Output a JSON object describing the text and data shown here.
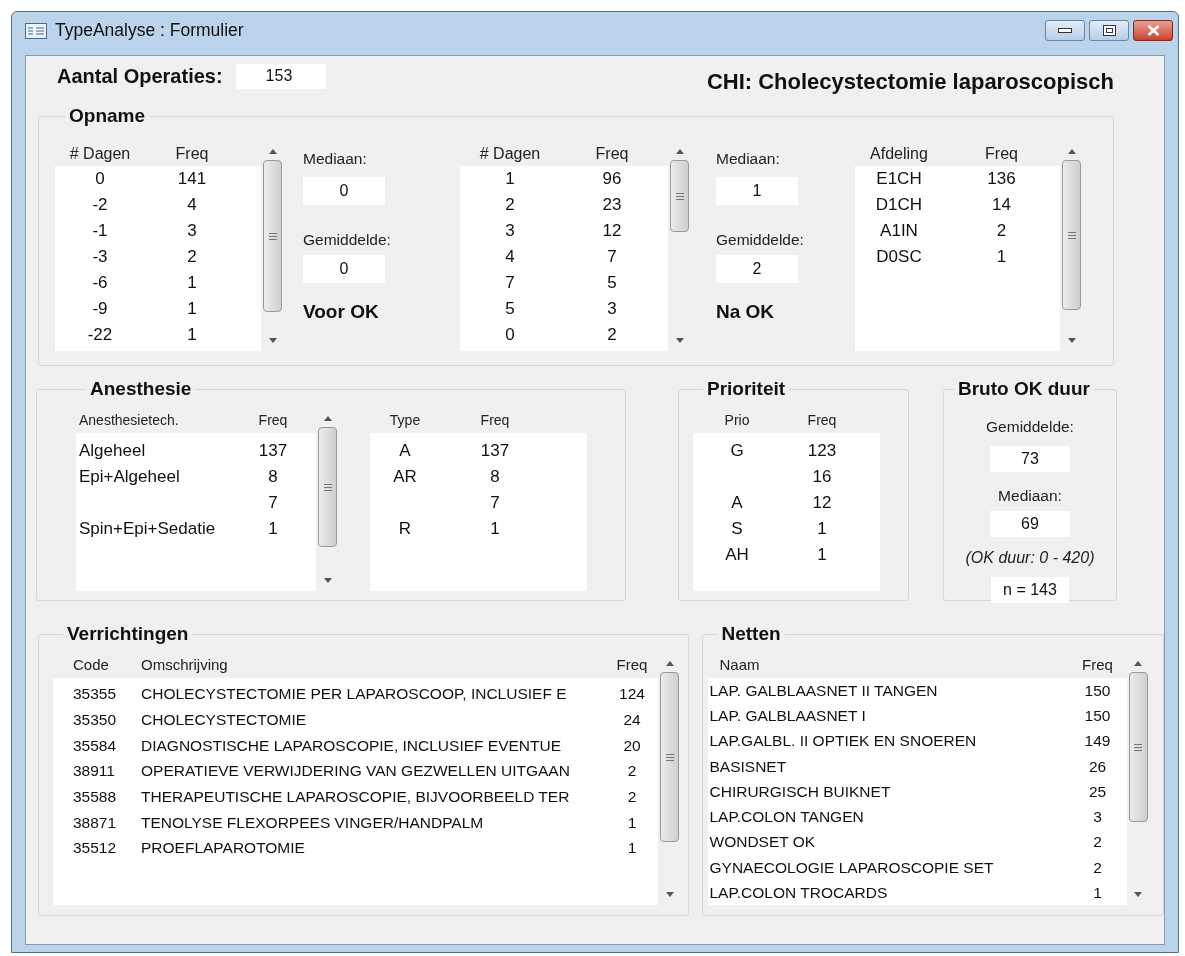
{
  "window": {
    "title": "TypeAnalyse : Formulier"
  },
  "aantal_operaties": {
    "label": "Aantal Operaties:",
    "value": "153"
  },
  "heading": "CHI: Cholecystectomie laparoscopisch",
  "opname": {
    "title": "Opname",
    "lists": [
      {
        "columns": [
          "# Dagen",
          "Freq"
        ],
        "scrollbar": true,
        "rows": [
          [
            "0",
            "141"
          ],
          [
            "-2",
            "4"
          ],
          [
            "-1",
            "3"
          ],
          [
            "-3",
            "2"
          ],
          [
            "-6",
            "1"
          ],
          [
            "-9",
            "1"
          ],
          [
            "-22",
            "1"
          ]
        ]
      },
      {
        "columns": [
          "# Dagen",
          "Freq"
        ],
        "scrollbar": true,
        "rows": [
          [
            "1",
            "96"
          ],
          [
            "2",
            "23"
          ],
          [
            "3",
            "12"
          ],
          [
            "4",
            "7"
          ],
          [
            "7",
            "5"
          ],
          [
            "5",
            "3"
          ],
          [
            "0",
            "2"
          ]
        ]
      },
      {
        "columns": [
          "Afdeling",
          "Freq"
        ],
        "scrollbar": true,
        "rows": [
          [
            "E1CH",
            "136"
          ],
          [
            "D1CH",
            "14"
          ],
          [
            "A1IN",
            "2"
          ],
          [
            "D0SC",
            "1"
          ]
        ]
      }
    ],
    "stats": [
      {
        "median_label": "Mediaan:",
        "median": "0",
        "mean_label": "Gemiddelde:",
        "mean": "0",
        "caption": "Voor OK"
      },
      {
        "median_label": "Mediaan:",
        "median": "1",
        "mean_label": "Gemiddelde:",
        "mean": "2",
        "caption": "Na OK"
      }
    ]
  },
  "anesthesie": {
    "title": "Anesthesie",
    "lists": [
      {
        "columns": [
          "Anesthesietech.",
          "Freq"
        ],
        "scrollbar": true,
        "rows": [
          [
            "Algeheel",
            "137"
          ],
          [
            "Epi+Algeheel",
            "8"
          ],
          [
            "",
            "7"
          ],
          [
            "Spin+Epi+Sedatie",
            "1"
          ]
        ]
      },
      {
        "columns": [
          "Type",
          "Freq"
        ],
        "scrollbar": false,
        "rows": [
          [
            "A",
            "137"
          ],
          [
            "AR",
            "8"
          ],
          [
            "",
            "7"
          ],
          [
            "R",
            "1"
          ]
        ]
      }
    ]
  },
  "prioriteit": {
    "title": "Prioriteit",
    "list": {
      "columns": [
        "Prio",
        "Freq"
      ],
      "scrollbar": false,
      "rows": [
        [
          "G",
          "123"
        ],
        [
          "",
          "16"
        ],
        [
          "A",
          "12"
        ],
        [
          "S",
          "1"
        ],
        [
          "AH",
          "1"
        ]
      ]
    }
  },
  "bruto_ok_duur": {
    "title": "Bruto OK duur",
    "mean_label": "Gemiddelde:",
    "mean": "73",
    "median_label": "Mediaan:",
    "median": "69",
    "range_note": "(OK duur: 0 - 420)",
    "count": "n = 143"
  },
  "verrichtingen": {
    "title": "Verrichtingen",
    "list": {
      "columns": [
        "Code",
        "Omschrijving",
        "Freq"
      ],
      "scrollbar": true,
      "rows": [
        [
          "35355",
          "CHOLECYSTECTOMIE PER LAPAROSCOOP, INCLUSIEF E",
          "124"
        ],
        [
          "35350",
          "CHOLECYSTECTOMIE",
          "24"
        ],
        [
          "35584",
          "DIAGNOSTISCHE LAPAROSCOPIE, INCLUSIEF EVENTUE",
          "20"
        ],
        [
          "38911",
          "OPERATIEVE VERWIJDERING VAN GEZWELLEN UITGAAN",
          "2"
        ],
        [
          "35588",
          "THERAPEUTISCHE LAPAROSCOPIE, BIJVOORBEELD TER",
          "2"
        ],
        [
          "38871",
          "TENOLYSE FLEXORPEES VINGER/HANDPALM",
          "1"
        ],
        [
          "35512",
          "PROEFLAPAROTOMIE",
          "1"
        ]
      ]
    }
  },
  "netten": {
    "title": "Netten",
    "list": {
      "columns": [
        "Naam",
        "Freq"
      ],
      "scrollbar": true,
      "rows": [
        [
          "LAP. GALBLAASNET II TANGEN",
          "150"
        ],
        [
          "LAP. GALBLAASNET I",
          "150"
        ],
        [
          "LAP.GALBL. II OPTIEK EN SNOEREN",
          "149"
        ],
        [
          "BASISNET",
          "26"
        ],
        [
          "CHIRURGISCH BUIKNET",
          "25"
        ],
        [
          "LAP.COLON TANGEN",
          "3"
        ],
        [
          "WONDSET OK",
          "2"
        ],
        [
          "GYNAECOLOGIE LAPAROSCOPIE SET",
          "2"
        ],
        [
          "LAP.COLON TROCARDS",
          "1"
        ]
      ]
    }
  }
}
